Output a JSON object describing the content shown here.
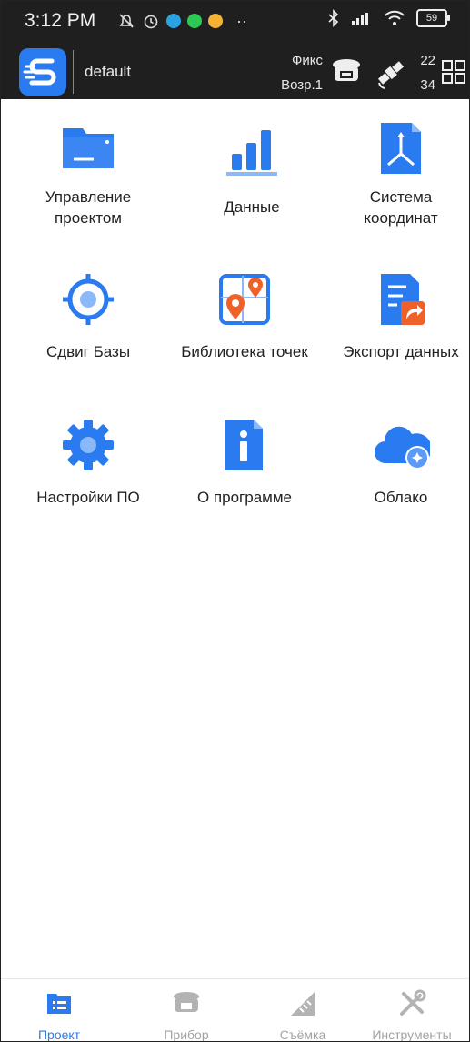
{
  "status_bar": {
    "time": "3:12 PM",
    "battery": "59"
  },
  "header": {
    "project_name": "default",
    "solution_label": "Фикс",
    "age_label": "Возр.1",
    "sat_count_used": "22",
    "sat_count_total": "34"
  },
  "tiles": [
    {
      "label_1": "Управление",
      "label_2": "проектом",
      "icon": "folder-icon"
    },
    {
      "label_1": "Данные",
      "label_2": "",
      "icon": "bar-chart-icon"
    },
    {
      "label_1": "Система",
      "label_2": "координат",
      "icon": "coordinate-system-icon"
    },
    {
      "label_1": "Сдвиг Базы",
      "label_2": "",
      "icon": "target-icon"
    },
    {
      "label_1": "Библиотека точек",
      "label_2": "",
      "icon": "map-pin-library-icon"
    },
    {
      "label_1": "Экспорт данных",
      "label_2": "",
      "icon": "export-document-icon"
    },
    {
      "label_1": "Настройки ПО",
      "label_2": "",
      "icon": "gear-icon"
    },
    {
      "label_1": "О программе",
      "label_2": "",
      "icon": "info-icon"
    },
    {
      "label_1": "Облако",
      "label_2": "",
      "icon": "cloud-icon"
    }
  ],
  "bottom_nav": [
    {
      "label": "Проект",
      "active": true,
      "icon": "project-list-icon"
    },
    {
      "label": "Прибор",
      "active": false,
      "icon": "gnss-receiver-icon"
    },
    {
      "label": "Съёмка",
      "active": false,
      "icon": "survey-ruler-icon"
    },
    {
      "label": "Инструменты",
      "active": false,
      "icon": "tools-icon"
    }
  ],
  "colors": {
    "accent": "#2A7BF0",
    "accent_light": "#5B9BF5",
    "orange": "#F0612A",
    "header_bg": "#1F1F1F",
    "inactive": "#A3A3A3"
  }
}
